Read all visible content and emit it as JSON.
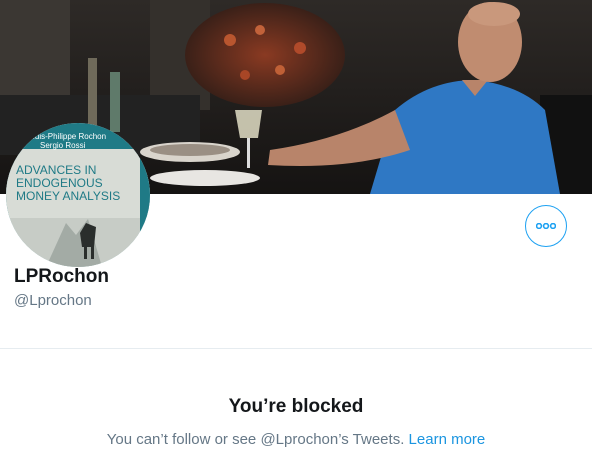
{
  "profile": {
    "display_name": "LPRochon",
    "handle": "@Lprochon"
  },
  "avatar": {
    "book_authors_line1": "Louis-Philippe Rochon",
    "book_authors_line2": "Sergio Rossi",
    "book_title_line1": "ADVANCES IN",
    "book_title_line2": "ENDOGENOUS",
    "book_title_line3": "MONEY ANALYSIS"
  },
  "actions": {
    "more_icon": "more-horizontal-icon"
  },
  "blocked": {
    "title": "You’re blocked",
    "message": "You can’t follow or see @Lprochon’s Tweets.",
    "learn_more": "Learn more"
  },
  "colors": {
    "accent": "#1da1f2",
    "link": "#1b95e0",
    "text_primary": "#14171a",
    "text_secondary": "#657786",
    "divider": "#e6ecf0"
  }
}
